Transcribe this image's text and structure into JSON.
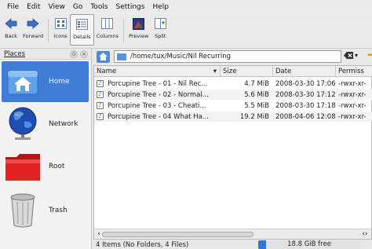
{
  "menubar": {
    "items": [
      {
        "label": "File",
        "key": "F"
      },
      {
        "label": "Edit",
        "key": "E"
      },
      {
        "label": "View",
        "key": "V"
      },
      {
        "label": "Go",
        "key": "G"
      },
      {
        "label": "Tools",
        "key": "T"
      },
      {
        "label": "Settings",
        "key": "S"
      },
      {
        "label": "Help",
        "key": "H"
      }
    ]
  },
  "toolbar": {
    "back_label": "Back",
    "forward_label": "Forward",
    "icons_label": "Icons",
    "details_label": "Details",
    "columns_label": "Columns",
    "preview_label": "Preview",
    "split_label": "Split",
    "active_view": "Details"
  },
  "places": {
    "title": "Places",
    "items": [
      {
        "label": "Home",
        "icon": "home-icon",
        "selected": true
      },
      {
        "label": "Network",
        "icon": "network-icon",
        "selected": false
      },
      {
        "label": "Root",
        "icon": "folder-icon",
        "selected": false
      },
      {
        "label": "Trash",
        "icon": "trash-icon",
        "selected": false
      }
    ]
  },
  "location": {
    "path": "/home/tux/Music/Nil Recurring"
  },
  "columns": {
    "name": "Name",
    "size": "Size",
    "date": "Date",
    "permissions": "Permiss"
  },
  "files": [
    {
      "name": "Porcupine Tree - 01 - Nil Rec...",
      "size": "4.7 MiB",
      "date": "2008-03-30 17:06",
      "perm": "-rwxr-xr-"
    },
    {
      "name": "Porcupine Tree - 02 - Normal...",
      "size": "5.6 MiB",
      "date": "2008-03-30 17:12",
      "perm": "-rwxr-xr-"
    },
    {
      "name": "Porcupine Tree - 03 - Cheati...",
      "size": "5.5 MiB",
      "date": "2008-03-30 17:18",
      "perm": "-rwxr-xr-"
    },
    {
      "name": "Porcupine Tree - 04 What Ha...",
      "size": "19.2 MiB",
      "date": "2008-04-06 12:08",
      "perm": "-rwxr-xr-"
    }
  ],
  "statusbar": {
    "text": "4 Items (No Folders, 4 Files)",
    "free_space": "18.8 GiB free"
  },
  "colors": {
    "accent": "#3f7dd6",
    "used_bar": "#3478d4"
  }
}
